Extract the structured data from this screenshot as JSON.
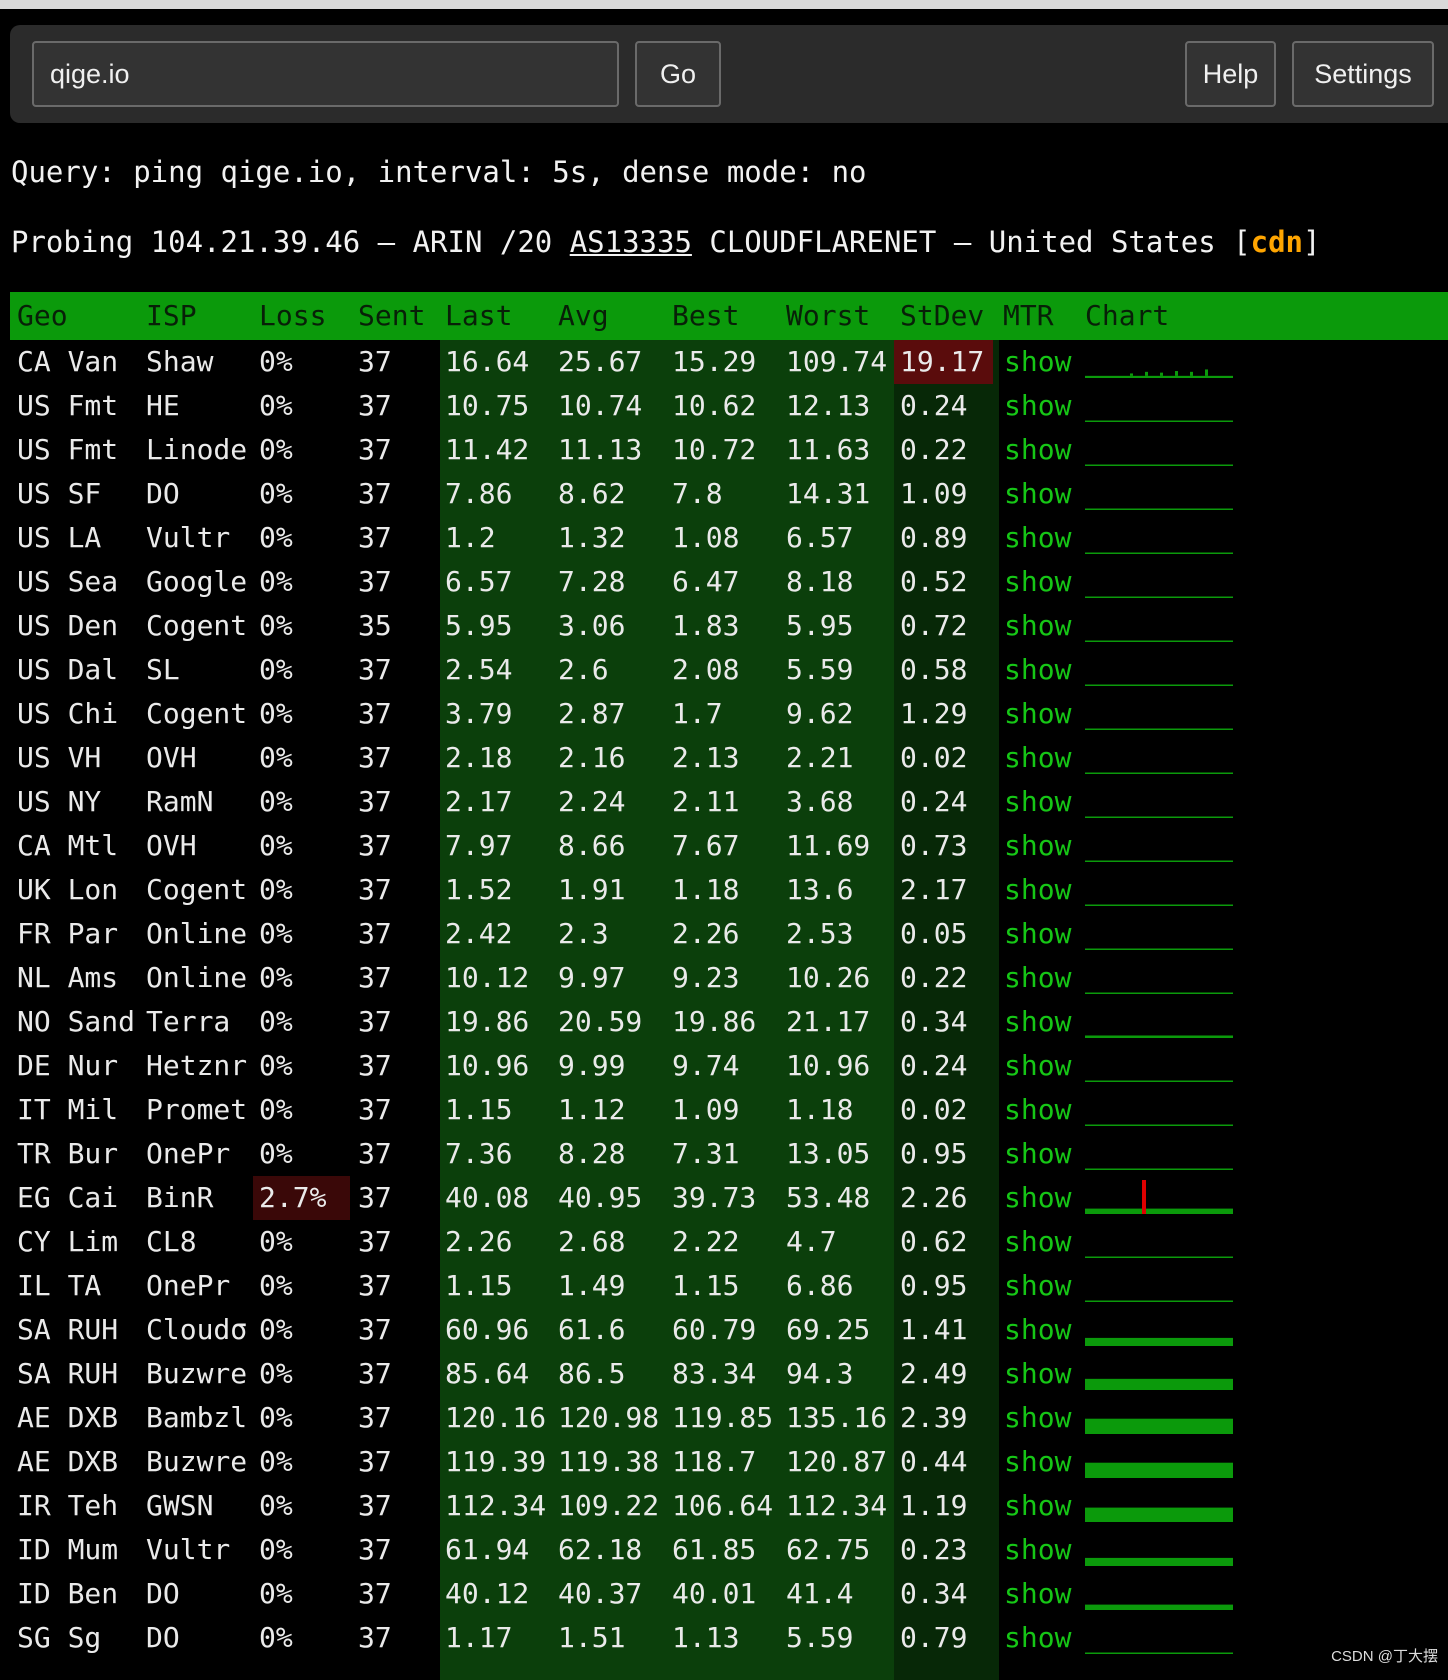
{
  "toolbar": {
    "search_value": "qige.io",
    "go_label": "Go",
    "help_label": "Help",
    "settings_label": "Settings"
  },
  "query_line": "Query: ping qige.io, interval: 5s, dense mode: no",
  "probe": {
    "prefix": "Probing 104.21.39.46 – ARIN /20 ",
    "asn": "AS13335",
    "suffix": " CLOUDFLARENET – United States [",
    "tag": "cdn",
    "close": "]"
  },
  "columns": [
    "Geo",
    "ISP",
    "Loss",
    "Sent",
    "Last",
    "Avg",
    "Best",
    "Worst",
    "StDev",
    "MTR",
    "Chart"
  ],
  "colors": {
    "header_bg": "#0b9a0b",
    "latency_bg": "#0b3f0b",
    "link": "#16c616",
    "loss_spike": "#e00000",
    "cdn": "#ffa500"
  },
  "rows": [
    {
      "geo": "CA Van",
      "isp": "Shaw",
      "loss": "0%",
      "sent": "37",
      "last": "16.64",
      "avg": "25.67",
      "best": "15.29",
      "worst": "109.74",
      "stdev": "19.17",
      "mtr": "show",
      "level": 0.12,
      "spikes": [
        0.3,
        0.5,
        0.4,
        0.6,
        0.5,
        0.8
      ],
      "stdev_hl": true
    },
    {
      "geo": "US Fmt",
      "isp": "HE",
      "loss": "0%",
      "sent": "37",
      "last": "10.75",
      "avg": "10.74",
      "best": "10.62",
      "worst": "12.13",
      "stdev": "0.24",
      "mtr": "show",
      "level": 0.08
    },
    {
      "geo": "US Fmt",
      "isp": "Linode",
      "loss": "0%",
      "sent": "37",
      "last": "11.42",
      "avg": "11.13",
      "best": "10.72",
      "worst": "11.63",
      "stdev": "0.22",
      "mtr": "show",
      "level": 0.08
    },
    {
      "geo": "US SF",
      "isp": "DO",
      "loss": "0%",
      "sent": "37",
      "last": "7.86",
      "avg": "8.62",
      "best": "7.8",
      "worst": "14.31",
      "stdev": "1.09",
      "mtr": "show",
      "level": 0.06
    },
    {
      "geo": "US LA",
      "isp": "Vultr",
      "loss": "0%",
      "sent": "37",
      "last": "1.2",
      "avg": "1.32",
      "best": "1.08",
      "worst": "6.57",
      "stdev": "0.89",
      "mtr": "show",
      "level": 0.02
    },
    {
      "geo": "US Sea",
      "isp": "Google",
      "loss": "0%",
      "sent": "37",
      "last": "6.57",
      "avg": "7.28",
      "best": "6.47",
      "worst": "8.18",
      "stdev": "0.52",
      "mtr": "show",
      "level": 0.06
    },
    {
      "geo": "US Den",
      "isp": "Cogent",
      "loss": "0%",
      "sent": "35",
      "last": "5.95",
      "avg": "3.06",
      "best": "1.83",
      "worst": "5.95",
      "stdev": "0.72",
      "mtr": "show",
      "level": 0.03
    },
    {
      "geo": "US Dal",
      "isp": "SL",
      "loss": "0%",
      "sent": "37",
      "last": "2.54",
      "avg": "2.6",
      "best": "2.08",
      "worst": "5.59",
      "stdev": "0.58",
      "mtr": "show",
      "level": 0.02
    },
    {
      "geo": "US Chi",
      "isp": "Cogent",
      "loss": "0%",
      "sent": "37",
      "last": "3.79",
      "avg": "2.87",
      "best": "1.7",
      "worst": "9.62",
      "stdev": "1.29",
      "mtr": "show",
      "level": 0.02
    },
    {
      "geo": "US VH",
      "isp": "OVH",
      "loss": "0%",
      "sent": "37",
      "last": "2.18",
      "avg": "2.16",
      "best": "2.13",
      "worst": "2.21",
      "stdev": "0.02",
      "mtr": "show",
      "level": 0.02
    },
    {
      "geo": "US NY",
      "isp": "RamN",
      "loss": "0%",
      "sent": "37",
      "last": "2.17",
      "avg": "2.24",
      "best": "2.11",
      "worst": "3.68",
      "stdev": "0.24",
      "mtr": "show",
      "level": 0.02
    },
    {
      "geo": "CA Mtl",
      "isp": "OVH",
      "loss": "0%",
      "sent": "37",
      "last": "7.97",
      "avg": "8.66",
      "best": "7.67",
      "worst": "11.69",
      "stdev": "0.73",
      "mtr": "show",
      "level": 0.06
    },
    {
      "geo": "UK Lon",
      "isp": "Cogent",
      "loss": "0%",
      "sent": "37",
      "last": "1.52",
      "avg": "1.91",
      "best": "1.18",
      "worst": "13.6",
      "stdev": "2.17",
      "mtr": "show",
      "level": 0.02
    },
    {
      "geo": "FR Par",
      "isp": "Online",
      "loss": "0%",
      "sent": "37",
      "last": "2.42",
      "avg": "2.3",
      "best": "2.26",
      "worst": "2.53",
      "stdev": "0.05",
      "mtr": "show",
      "level": 0.02
    },
    {
      "geo": "NL Ams",
      "isp": "Online",
      "loss": "0%",
      "sent": "37",
      "last": "10.12",
      "avg": "9.97",
      "best": "9.23",
      "worst": "10.26",
      "stdev": "0.22",
      "mtr": "show",
      "level": 0.08
    },
    {
      "geo": "NO Sand",
      "isp": "Terra",
      "loss": "0%",
      "sent": "37",
      "last": "19.86",
      "avg": "20.59",
      "best": "19.86",
      "worst": "21.17",
      "stdev": "0.34",
      "mtr": "show",
      "level": 0.14
    },
    {
      "geo": "DE Nur",
      "isp": "Hetznr",
      "loss": "0%",
      "sent": "37",
      "last": "10.96",
      "avg": "9.99",
      "best": "9.74",
      "worst": "10.96",
      "stdev": "0.24",
      "mtr": "show",
      "level": 0.08
    },
    {
      "geo": "IT Mil",
      "isp": "Promet",
      "loss": "0%",
      "sent": "37",
      "last": "1.15",
      "avg": "1.12",
      "best": "1.09",
      "worst": "1.18",
      "stdev": "0.02",
      "mtr": "show",
      "level": 0.02
    },
    {
      "geo": "TR Bur",
      "isp": "OnePr",
      "loss": "0%",
      "sent": "37",
      "last": "7.36",
      "avg": "8.28",
      "best": "7.31",
      "worst": "13.05",
      "stdev": "0.95",
      "mtr": "show",
      "level": 0.06
    },
    {
      "geo": "EG Cai",
      "isp": "BinR",
      "loss": "2.7%",
      "sent": "37",
      "last": "40.08",
      "avg": "40.95",
      "best": "39.73",
      "worst": "53.48",
      "stdev": "2.26",
      "mtr": "show",
      "level": 0.3,
      "loss_spike": true
    },
    {
      "geo": "CY Lim",
      "isp": "CL8",
      "loss": "0%",
      "sent": "37",
      "last": "2.26",
      "avg": "2.68",
      "best": "2.22",
      "worst": "4.7",
      "stdev": "0.62",
      "mtr": "show",
      "level": 0.02
    },
    {
      "geo": "IL TA",
      "isp": "OnePr",
      "loss": "0%",
      "sent": "37",
      "last": "1.15",
      "avg": "1.49",
      "best": "1.15",
      "worst": "6.86",
      "stdev": "0.95",
      "mtr": "show",
      "level": 0.02
    },
    {
      "geo": "SA RUH",
      "isp": "Cloudσ",
      "loss": "0%",
      "sent": "37",
      "last": "60.96",
      "avg": "61.6",
      "best": "60.79",
      "worst": "69.25",
      "stdev": "1.41",
      "mtr": "show",
      "level": 0.45
    },
    {
      "geo": "SA RUH",
      "isp": "Buzwre",
      "loss": "0%",
      "sent": "37",
      "last": "85.64",
      "avg": "86.5",
      "best": "83.34",
      "worst": "94.3",
      "stdev": "2.49",
      "mtr": "show",
      "level": 0.62
    },
    {
      "geo": "AE DXB",
      "isp": "Bambzl",
      "loss": "0%",
      "sent": "37",
      "last": "120.16",
      "avg": "120.98",
      "best": "119.85",
      "worst": "135.16",
      "stdev": "2.39",
      "mtr": "show",
      "level": 0.85
    },
    {
      "geo": "AE DXB",
      "isp": "Buzwre",
      "loss": "0%",
      "sent": "37",
      "last": "119.39",
      "avg": "119.38",
      "best": "118.7",
      "worst": "120.87",
      "stdev": "0.44",
      "mtr": "show",
      "level": 0.85
    },
    {
      "geo": "IR Teh",
      "isp": "GWSN",
      "loss": "0%",
      "sent": "37",
      "last": "112.34",
      "avg": "109.22",
      "best": "106.64",
      "worst": "112.34",
      "stdev": "1.19",
      "mtr": "show",
      "level": 0.8
    },
    {
      "geo": "ID Mum",
      "isp": "Vultr",
      "loss": "0%",
      "sent": "37",
      "last": "61.94",
      "avg": "62.18",
      "best": "61.85",
      "worst": "62.75",
      "stdev": "0.23",
      "mtr": "show",
      "level": 0.45
    },
    {
      "geo": "ID Ben",
      "isp": "DO",
      "loss": "0%",
      "sent": "37",
      "last": "40.12",
      "avg": "40.37",
      "best": "40.01",
      "worst": "41.4",
      "stdev": "0.34",
      "mtr": "show",
      "level": 0.3
    },
    {
      "geo": "SG Sg",
      "isp": "DO",
      "loss": "0%",
      "sent": "37",
      "last": "1.17",
      "avg": "1.51",
      "best": "1.13",
      "worst": "5.59",
      "stdev": "0.79",
      "mtr": "show",
      "level": 0.02
    }
  ],
  "watermark": "CSDN @丁大摆"
}
